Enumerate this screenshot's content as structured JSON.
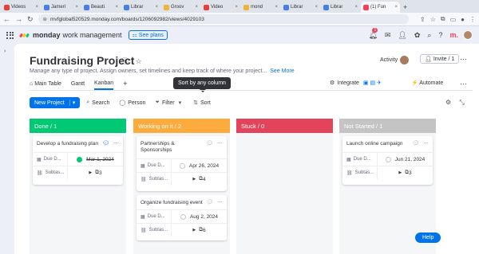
{
  "browser": {
    "tabs": [
      {
        "label": "Videos",
        "color": "#e83e3e"
      },
      {
        "label": "Jameri",
        "color": "#4a7de8"
      },
      {
        "label": "Beauti",
        "color": "#4a7de8"
      },
      {
        "label": "Librar",
        "color": "#4a7de8"
      },
      {
        "label": "Groov",
        "color": "#f0b33a"
      },
      {
        "label": "Video",
        "color": "#e83e3e"
      },
      {
        "label": "mond",
        "color": "#f0b33a"
      },
      {
        "label": "Librar",
        "color": "#4a7de8"
      },
      {
        "label": "Librar",
        "color": "#4a7de8"
      },
      {
        "label": "(1) Fun",
        "color": "#ff3d57"
      }
    ],
    "new_tab": "+",
    "url": "mvfglobal520529.monday.com/boards/1206092982/views/4029103"
  },
  "app": {
    "brand": "monday",
    "brand_sub": "work management",
    "see_plans": "See plans",
    "notification_count": "1"
  },
  "board": {
    "title": "Fundraising Project",
    "description": "Manage any type of project. Assign owners, set timelines and keep track of where your project...",
    "see_more": "See More",
    "activity": "Activity",
    "invite": "Invite / 1",
    "views": [
      {
        "label": "Main Table"
      },
      {
        "label": "Gantt"
      },
      {
        "label": "Kanban"
      }
    ],
    "add_view": "+",
    "integrate": "Integrate",
    "automate": "Automate",
    "tooltip": "Sort by any column"
  },
  "toolbar": {
    "new_project": "New Project",
    "search": "Search",
    "person": "Person",
    "filter": "Filter",
    "sort": "Sort"
  },
  "columns": [
    {
      "label": "Done / 1",
      "color": "#00c875",
      "cards": [
        {
          "title": "Develop a fundraising plan",
          "due_label": "Due D...",
          "due_date": "Mar 1, 2024",
          "done": true,
          "subtasks_label": "Subtas...",
          "subtasks_count": "3"
        }
      ]
    },
    {
      "label": "Working on it / 2",
      "color": "#fdab3d",
      "cards": [
        {
          "title": "Partnerships & Sponsorships",
          "due_label": "Due D...",
          "due_date": "Apr 26, 2024",
          "done": false,
          "subtasks_label": "Subtas...",
          "subtasks_count": "4"
        },
        {
          "title": "Organize fundraising event",
          "due_label": "Due D...",
          "due_date": "Aug 2, 2024",
          "done": false,
          "subtasks_label": "Subtas...",
          "subtasks_count": "6"
        }
      ]
    },
    {
      "label": "Stuck / 0",
      "color": "#e2445c",
      "cards": []
    },
    {
      "label": "Not Started / 1",
      "color": "#c4c4c4",
      "cards": [
        {
          "title": "Launch online campaign",
          "due_label": "Due D...",
          "due_date": "Jun 21, 2024",
          "done": false,
          "subtasks_label": "Subtas...",
          "subtasks_count": "3"
        }
      ]
    }
  ],
  "help": "Help"
}
